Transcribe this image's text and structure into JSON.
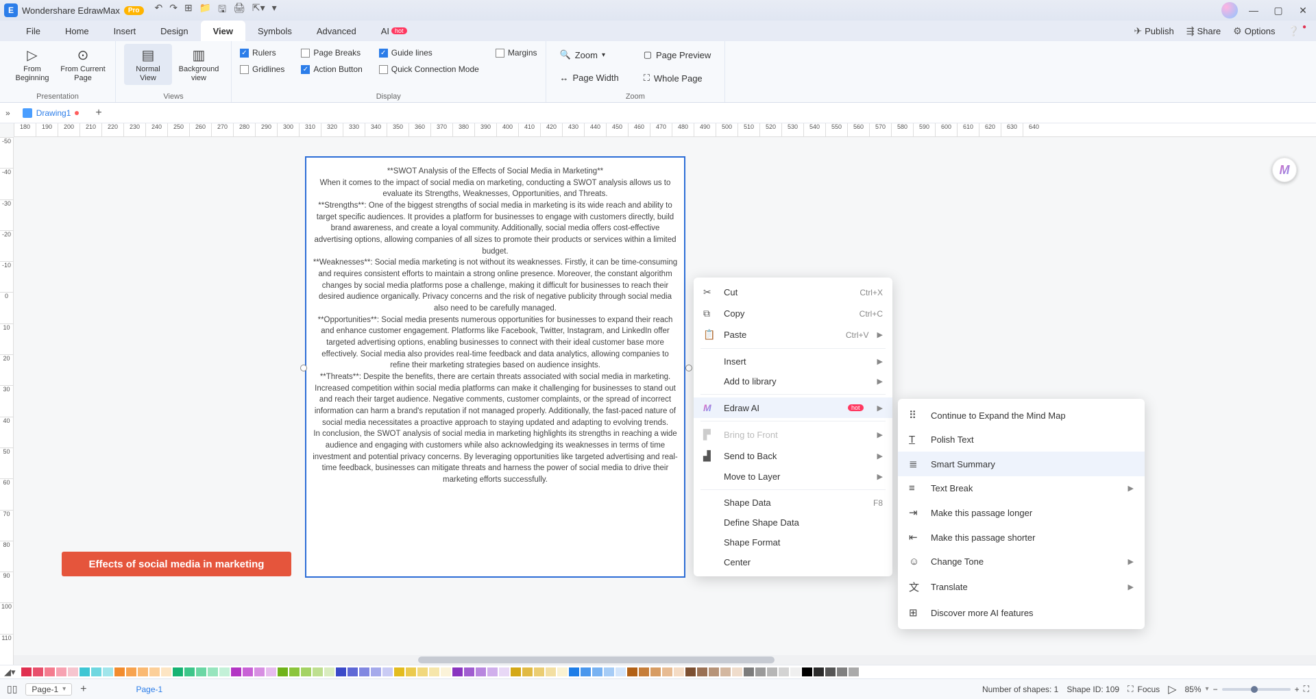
{
  "title_bar": {
    "app_name": "Wondershare EdrawMax",
    "pro": "Pro"
  },
  "menu": {
    "file": "File",
    "home": "Home",
    "insert": "Insert",
    "design": "Design",
    "view": "View",
    "symbols": "Symbols",
    "advanced": "Advanced",
    "ai": "AI",
    "hot": "hot"
  },
  "right_actions": {
    "publish": "Publish",
    "share": "Share",
    "options": "Options"
  },
  "ribbon": {
    "presentation": {
      "label": "Presentation",
      "from_beginning": "From\nBeginning",
      "from_current": "From Current\nPage"
    },
    "views": {
      "label": "Views",
      "normal": "Normal\nView",
      "background": "Background\nview"
    },
    "display": {
      "label": "Display",
      "rulers": "Rulers",
      "page_breaks": "Page Breaks",
      "guide_lines": "Guide lines",
      "margins": "Margins",
      "gridlines": "Gridlines",
      "action_button": "Action Button",
      "quick_connection": "Quick Connection Mode"
    },
    "zoom": {
      "label": "Zoom",
      "zoom": "Zoom",
      "page_preview": "Page Preview",
      "page_width": "Page Width",
      "whole_page": "Whole Page"
    }
  },
  "doc_tab": {
    "name": "Drawing1"
  },
  "ruler_h": [
    "180",
    "190",
    "200",
    "210",
    "220",
    "230",
    "240",
    "250",
    "260",
    "270",
    "280",
    "290",
    "300",
    "310",
    "320",
    "330",
    "340",
    "350",
    "360",
    "370",
    "380",
    "390",
    "400",
    "410",
    "420",
    "430",
    "440",
    "450",
    "460",
    "470",
    "480",
    "490",
    "500",
    "510",
    "520",
    "530",
    "540",
    "550",
    "560",
    "570",
    "580",
    "590",
    "600",
    "610",
    "620",
    "630",
    "640"
  ],
  "ruler_v": [
    "-50",
    "-40",
    "-30",
    "-20",
    "-10",
    "0",
    "10",
    "20",
    "30",
    "40",
    "50",
    "60",
    "70",
    "80",
    "90",
    "100",
    "110"
  ],
  "swot": {
    "title": "**SWOT Analysis of the Effects of Social Media in Marketing**",
    "intro": "When it comes to the impact of social media on marketing, conducting a SWOT analysis allows us to evaluate its Strengths, Weaknesses, Opportunities, and Threats.",
    "strengths": "**Strengths**: One of the biggest strengths of social media in marketing is its wide reach and ability to target specific audiences. It provides a platform for businesses to engage with customers directly, build brand awareness, and create a loyal community. Additionally, social media offers cost-effective advertising options, allowing companies of all sizes to promote their products or services within a limited budget.",
    "weaknesses": "**Weaknesses**: Social media marketing is not without its weaknesses. Firstly, it can be time-consuming and requires consistent efforts to maintain a strong online presence. Moreover, the constant algorithm changes by social media platforms pose a challenge, making it difficult for businesses to reach their desired audience organically. Privacy concerns and the risk of negative publicity through social media also need to be carefully managed.",
    "opportunities": "**Opportunities**: Social media presents numerous opportunities for businesses to expand their reach and enhance customer engagement. Platforms like Facebook, Twitter, Instagram, and LinkedIn offer targeted advertising options, enabling businesses to connect with their ideal customer base more effectively. Social media also provides real-time feedback and data analytics, allowing companies to refine their marketing strategies based on audience insights.",
    "threats": "**Threats**: Despite the benefits, there are certain threats associated with social media in marketing. Increased competition within social media platforms can make it challenging for businesses to stand out and reach their target audience. Negative comments, customer complaints, or the spread of incorrect information can harm a brand's reputation if not managed properly. Additionally, the fast-paced nature of social media necessitates a proactive approach to staying updated and adapting to evolving trends.",
    "conclusion": "In conclusion, the SWOT analysis of social media in marketing highlights its strengths in reaching a wide audience and engaging with customers while also acknowledging its weaknesses in terms of time investment and potential privacy concerns. By leveraging opportunities like targeted advertising and real-time feedback, businesses can mitigate threats and harness the power of social media to drive their marketing efforts successfully."
  },
  "tag": {
    "label": "Effects of social media in marketing"
  },
  "context_menu": {
    "cut": "Cut",
    "cut_sc": "Ctrl+X",
    "copy": "Copy",
    "copy_sc": "Ctrl+C",
    "paste": "Paste",
    "paste_sc": "Ctrl+V",
    "insert": "Insert",
    "add_to_library": "Add to library",
    "edraw_ai": "Edraw AI",
    "hot": "hot",
    "bring_to_front": "Bring to Front",
    "send_to_back": "Send to Back",
    "move_to_layer": "Move to Layer",
    "shape_data": "Shape Data",
    "shape_data_sc": "F8",
    "define_shape_data": "Define Shape Data",
    "shape_format": "Shape Format",
    "center": "Center"
  },
  "ai_menu": {
    "expand": "Continue to Expand the Mind Map",
    "polish": "Polish Text",
    "summary": "Smart Summary",
    "text_break": "Text Break",
    "longer": "Make this passage longer",
    "shorter": "Make this passage shorter",
    "change_tone": "Change Tone",
    "translate": "Translate",
    "discover": "Discover more AI features"
  },
  "palette": [
    "#e03050",
    "#e8506c",
    "#f47c8f",
    "#f7a2b2",
    "#f6c5cf",
    "#3ec6d4",
    "#6fd7e0",
    "#a1e5eb",
    "#f28c2e",
    "#f7a34f",
    "#fab972",
    "#fccf99",
    "#fde5c4",
    "#17b373",
    "#3dc68a",
    "#6ad7a4",
    "#97e5be",
    "#c3f1d8",
    "#b235c4",
    "#c862d6",
    "#d78fe2",
    "#e6bcee",
    "#6fb31a",
    "#8bc53c",
    "#a4d364",
    "#bedf90",
    "#d9ecbf",
    "#3b4ac9",
    "#5e68d6",
    "#8188e1",
    "#a5aaeb",
    "#c9cbf4",
    "#e3bc1f",
    "#ebca4e",
    "#f1d87d",
    "#f6e6ab",
    "#fbf3d9",
    "#8935c0",
    "#a05dd0",
    "#b886df",
    "#d0afec",
    "#e8d8f6",
    "#d4a817",
    "#e1ba44",
    "#ebcd72",
    "#f3dfa2",
    "#faf2d2",
    "#1d7de8",
    "#4a97ed",
    "#78b2f2",
    "#a6ccf6",
    "#d3e5fb",
    "#b26116",
    "#c67e3a",
    "#d79c63",
    "#e7bb92",
    "#f4dbc4",
    "#7c5032",
    "#9a7154",
    "#b69378",
    "#d3b7a0",
    "#efdccb",
    "#7c7c7c",
    "#9a9a9a",
    "#b6b6b6",
    "#d3d3d3",
    "#efefef",
    "#000000",
    "#2b2b2b",
    "#555555",
    "#808080",
    "#aaaaaa",
    "#ffffff"
  ],
  "status": {
    "page_sel": "Page-1",
    "page_tab": "Page-1",
    "shapes": "Number of shapes: 1",
    "shape_id": "Shape ID: 109",
    "focus": "Focus",
    "zoom": "85%"
  }
}
